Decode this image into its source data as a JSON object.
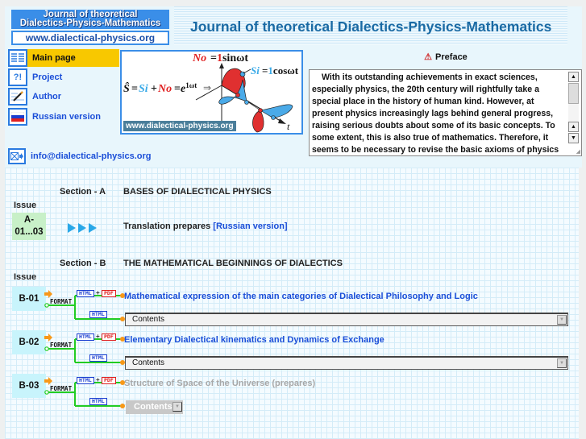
{
  "header": {
    "logo_line1": "Journal of theoretical",
    "logo_line2": "Dialectics-Physics-Mathematics",
    "logo_url": "www.dialectical-physics.org",
    "site_title": "Journal of theoretical Dialectics-Physics-Mathematics"
  },
  "nav": {
    "items": [
      {
        "label": "Main page",
        "icon": "book-icon",
        "active": true
      },
      {
        "label": "Project",
        "icon": "question-exclamation-icon",
        "active": false
      },
      {
        "label": "Author",
        "icon": "pen-icon",
        "active": false
      },
      {
        "label": "Russian version",
        "icon": "russian-flag-icon",
        "active": false
      }
    ],
    "email": "info@dialectical-physics.org"
  },
  "banner": {
    "formula_no": "No=1sinωt",
    "formula_si": "Si=1cosωt",
    "formula_s_hat": "Ŝ=Si+No=e",
    "formula_exp": "1ωt",
    "axis_t": "t",
    "url": "www.dialectical-physics.org"
  },
  "preface": {
    "title": "Preface",
    "text": "With its outstanding achievements in exact sciences, especially physics, the 20th century will rightfully take a special place in the history of human kind. However, at present physics increasingly lags behind general progress, raising serious doubts about some of its basic concepts. To some extent, this is also true of mathematics. Therefore, it seems to be necessary to revise the basic axioms of physics and"
  },
  "sections": [
    {
      "label": "Section - A",
      "title": "BASES OF DIALECTICAL PHYSICS",
      "issue_header": "Issue",
      "issues": [
        {
          "id_line1": "A-",
          "id_line2": "01...03",
          "text": "Translation prepares",
          "link": "[Russian version]"
        }
      ]
    },
    {
      "label": "Section - B",
      "title": "THE MATHEMATICAL BEGINNINGS OF DIALECTICS",
      "issue_header": "Issue",
      "issues": [
        {
          "id": "B-01",
          "title": "Mathematical expression of the main categories of Dialectical Philosophy and Logic",
          "contents": "Contents",
          "available": true
        },
        {
          "id": "B-02",
          "title": "Elementary Dialectical kinematics and Dynamics of Exchange",
          "contents": "Contents",
          "available": true
        },
        {
          "id": "B-03",
          "title": "Structure of Space of the Universe (prepares)",
          "contents": "Contents",
          "available": false
        }
      ]
    }
  ],
  "format": {
    "word": "FORMAT",
    "html": "HTML",
    "pdf": "PDF",
    "plus": "+"
  },
  "colors": {
    "accent_blue": "#3a8ee8",
    "link_blue": "#1a4ed8",
    "active_nav": "#f8c800",
    "issue_a_bg": "#c8f0c8",
    "issue_b_bg": "#c8f4fc",
    "connector_green": "#22cc22",
    "connector_orange": "#f89818"
  }
}
